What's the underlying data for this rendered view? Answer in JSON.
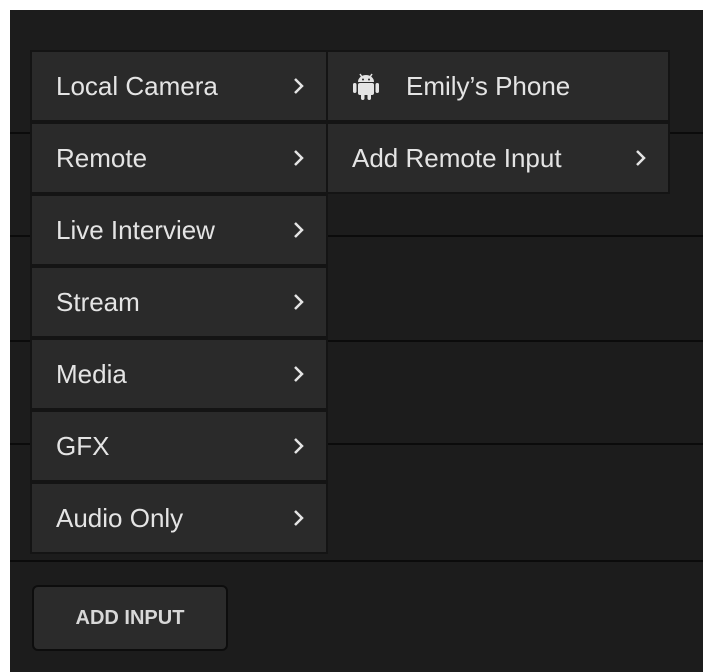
{
  "menu": {
    "items": [
      {
        "label": "Local Camera"
      },
      {
        "label": "Remote"
      },
      {
        "label": "Live Interview"
      },
      {
        "label": "Stream"
      },
      {
        "label": "Media"
      },
      {
        "label": "GFX"
      },
      {
        "label": "Audio Only"
      }
    ]
  },
  "submenu": {
    "items": [
      {
        "label": "Emily’s Phone",
        "icon": "android-icon"
      },
      {
        "label": "Add Remote Input"
      }
    ]
  },
  "add_input": {
    "label": "ADD INPUT"
  }
}
